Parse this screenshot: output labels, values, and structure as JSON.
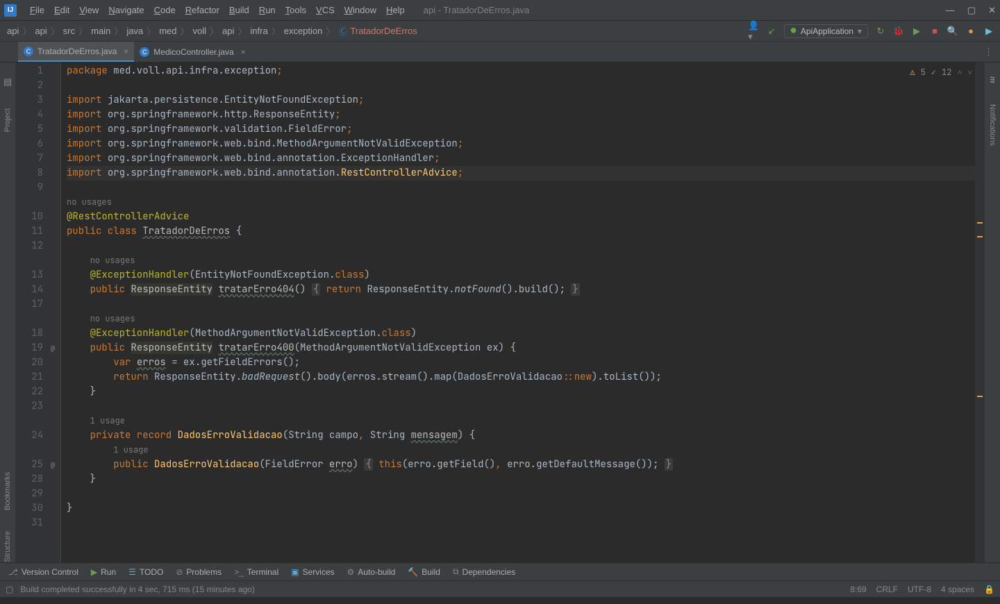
{
  "window": {
    "title": "api - TratadorDeErros.java"
  },
  "menu": [
    "File",
    "Edit",
    "View",
    "Navigate",
    "Code",
    "Refactor",
    "Build",
    "Run",
    "Tools",
    "VCS",
    "Window",
    "Help"
  ],
  "breadcrumbs": [
    "api",
    "api",
    "src",
    "main",
    "java",
    "med",
    "voll",
    "api",
    "infra",
    "exception",
    "TratadorDeErros"
  ],
  "run_config": "ApiApplication",
  "tabs": [
    {
      "name": "TratadorDeErros.java",
      "active": true
    },
    {
      "name": "MedicoController.java",
      "active": false
    }
  ],
  "left_tools": [
    "Project",
    "Bookmarks",
    "Structure"
  ],
  "right_tools": [
    "Maven",
    "Notifications"
  ],
  "inspections": {
    "warnings": "5",
    "weak": "12"
  },
  "lines": {
    "1": {
      "n": "1",
      "tokens": [
        [
          "kw",
          "package "
        ],
        [
          "id",
          "med.voll.api.infra.exception"
        ],
        [
          "kw",
          ";"
        ]
      ]
    },
    "2": {
      "n": "2",
      "tokens": []
    },
    "3": {
      "n": "3",
      "tokens": [
        [
          "kw",
          "import "
        ],
        [
          "id",
          "jakarta.persistence.EntityNotFoundException"
        ],
        [
          "kw",
          ";"
        ]
      ]
    },
    "4": {
      "n": "4",
      "tokens": [
        [
          "kw",
          "import "
        ],
        [
          "id",
          "org.springframework.http.ResponseEntity"
        ],
        [
          "kw",
          ";"
        ]
      ]
    },
    "5": {
      "n": "5",
      "tokens": [
        [
          "kw",
          "import "
        ],
        [
          "id",
          "org.springframework.validation.FieldError"
        ],
        [
          "kw",
          ";"
        ]
      ]
    },
    "6": {
      "n": "6",
      "tokens": [
        [
          "kw",
          "import "
        ],
        [
          "id",
          "org.springframework.web.bind.MethodArgumentNotValidException"
        ],
        [
          "kw",
          ";"
        ]
      ]
    },
    "7": {
      "n": "7",
      "tokens": [
        [
          "kw",
          "import "
        ],
        [
          "id",
          "org.springframework.web.bind.annotation.ExceptionHandler"
        ],
        [
          "kw",
          ";"
        ]
      ]
    },
    "8": {
      "n": "8",
      "cur": true,
      "tokens": [
        [
          "kw",
          "import "
        ],
        [
          "id",
          "org.springframework.web.bind.annotation."
        ],
        [
          "mtd",
          "RestControllerAdvice"
        ],
        [
          "kw",
          ";"
        ]
      ]
    },
    "9": {
      "n": "9",
      "tokens": []
    },
    "h1": {
      "hint": "no usages"
    },
    "10": {
      "n": "10",
      "tokens": [
        [
          "ann",
          "@RestControllerAdvice"
        ]
      ]
    },
    "11": {
      "n": "11",
      "tokens": [
        [
          "kw",
          "public class "
        ],
        [
          "under",
          "TratadorDeErros"
        ],
        [
          "id",
          " {"
        ]
      ]
    },
    "12": {
      "n": "12",
      "tokens": []
    },
    "h2": {
      "hint": "no usages",
      "indent": "    "
    },
    "13": {
      "n": "13",
      "tokens": [
        [
          "id",
          "    "
        ],
        [
          "ann",
          "@ExceptionHandler"
        ],
        [
          "id",
          "(EntityNotFoundException."
        ],
        [
          "kw",
          "class"
        ],
        [
          "id",
          ")"
        ]
      ]
    },
    "14": {
      "n": "14",
      "tokens": [
        [
          "id",
          "    "
        ],
        [
          "kw",
          "public "
        ],
        [
          "hl",
          "ResponseEntity"
        ],
        [
          "id",
          " "
        ],
        [
          "under",
          "tratarErro404"
        ],
        [
          "id",
          "() "
        ],
        [
          "fold",
          "{"
        ],
        [
          "id",
          " "
        ],
        [
          "kw",
          "return "
        ],
        [
          "id",
          "ResponseEntity."
        ],
        [
          "ital",
          "notFound"
        ],
        [
          "id",
          "().build(); "
        ],
        [
          "fold",
          "}"
        ]
      ]
    },
    "17": {
      "n": "17",
      "tokens": []
    },
    "h3": {
      "hint": "no usages",
      "indent": "    "
    },
    "18": {
      "n": "18",
      "tokens": [
        [
          "id",
          "    "
        ],
        [
          "ann",
          "@ExceptionHandler"
        ],
        [
          "id",
          "(MethodArgumentNotValidException."
        ],
        [
          "kw",
          "class"
        ],
        [
          "id",
          ")"
        ]
      ]
    },
    "19": {
      "n": "19",
      "mk": "@",
      "tokens": [
        [
          "id",
          "    "
        ],
        [
          "kw",
          "public "
        ],
        [
          "hl",
          "ResponseEntity"
        ],
        [
          "id",
          " "
        ],
        [
          "under",
          "tratarErro400"
        ],
        [
          "id",
          "(MethodArgumentNotValidException ex) {"
        ]
      ]
    },
    "20": {
      "n": "20",
      "tokens": [
        [
          "id",
          "        "
        ],
        [
          "kw",
          "var "
        ],
        [
          "under",
          "erros"
        ],
        [
          "id",
          " = ex.getFieldErrors();"
        ]
      ]
    },
    "21": {
      "n": "21",
      "tokens": [
        [
          "id",
          "        "
        ],
        [
          "kw",
          "return "
        ],
        [
          "id",
          "ResponseEntity."
        ],
        [
          "ital",
          "badRequest"
        ],
        [
          "id",
          "().body(erros.stream().map(DadosErroValidacao"
        ],
        [
          "kw",
          "::new"
        ],
        [
          "id",
          ").toList());"
        ]
      ]
    },
    "22": {
      "n": "22",
      "tokens": [
        [
          "id",
          "    }"
        ]
      ]
    },
    "23": {
      "n": "23",
      "tokens": []
    },
    "h4": {
      "hint": "1 usage",
      "indent": "    "
    },
    "24": {
      "n": "24",
      "tokens": [
        [
          "id",
          "    "
        ],
        [
          "kw",
          "private record "
        ],
        [
          "mtd",
          "DadosErroValidacao"
        ],
        [
          "id",
          "(String campo"
        ],
        [
          "kw",
          ","
        ],
        [
          "id",
          " String "
        ],
        [
          "under",
          "mensagem"
        ],
        [
          "id",
          ") {"
        ]
      ]
    },
    "h5": {
      "hint": "1 usage",
      "indent": "        "
    },
    "25": {
      "n": "25",
      "mk": "@",
      "tokens": [
        [
          "id",
          "        "
        ],
        [
          "kw",
          "public "
        ],
        [
          "mtd",
          "DadosErroValidacao"
        ],
        [
          "id",
          "(FieldError "
        ],
        [
          "under",
          "erro"
        ],
        [
          "id",
          ") "
        ],
        [
          "fold",
          "{"
        ],
        [
          "id",
          " "
        ],
        [
          "kw",
          "this"
        ],
        [
          "id",
          "(erro.getField()"
        ],
        [
          "kw",
          ","
        ],
        [
          "id",
          " erro.getDefaultMessage()); "
        ],
        [
          "fold",
          "}"
        ]
      ]
    },
    "28": {
      "n": "28",
      "tokens": [
        [
          "id",
          "    }"
        ]
      ]
    },
    "29": {
      "n": "29",
      "tokens": []
    },
    "30": {
      "n": "30",
      "tokens": [
        [
          "id",
          "}"
        ]
      ]
    },
    "31": {
      "n": "31",
      "tokens": []
    }
  },
  "line_order": [
    "1",
    "2",
    "3",
    "4",
    "5",
    "6",
    "7",
    "8",
    "9",
    "h1",
    "10",
    "11",
    "12",
    "h2",
    "13",
    "14",
    "17",
    "h3",
    "18",
    "19",
    "20",
    "21",
    "22",
    "23",
    "h4",
    "24",
    "h5",
    "25",
    "28",
    "29",
    "30",
    "31"
  ],
  "bottom_tools": [
    "Version Control",
    "Run",
    "TODO",
    "Problems",
    "Terminal",
    "Services",
    "Auto-build",
    "Build",
    "Dependencies"
  ],
  "status": {
    "msg": "Build completed successfully in 4 sec, 715 ms (15 minutes ago)",
    "pos": "8:69",
    "le": "CRLF",
    "enc": "UTF-8",
    "indent": "4 spaces"
  }
}
